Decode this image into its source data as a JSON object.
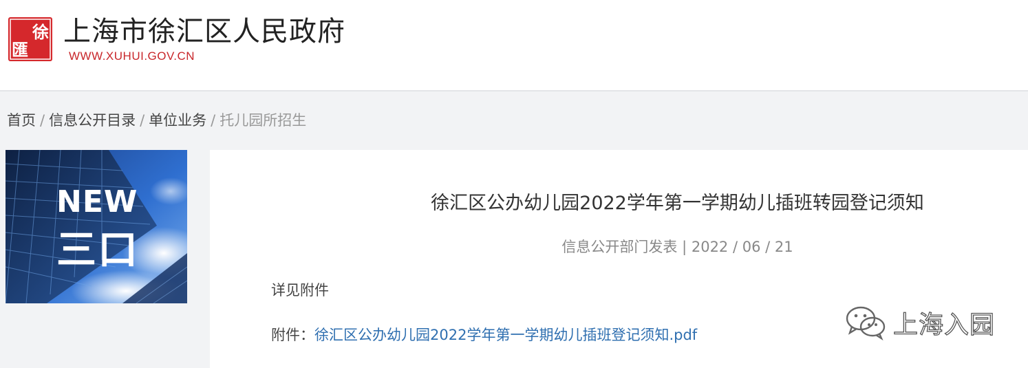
{
  "header": {
    "seal_glyphs": [
      "徐",
      "匯"
    ],
    "site_name": "上海市徐汇区人民政府",
    "site_url": "WWW.XUHUI.GOV.CN"
  },
  "breadcrumb": {
    "items": [
      "首页",
      "信息公开目录",
      "单位业务"
    ],
    "current": "托儿园所招生",
    "separator": "/"
  },
  "banner": {
    "title": "NEW",
    "subtitle": "三口"
  },
  "article": {
    "title": "徐汇区公办幼儿园2022学年第一学期幼儿插班转园登记须知",
    "publisher": "信息公开部门发表",
    "date": "2022 / 06 / 21",
    "meta_separator": "|",
    "body": "详见附件",
    "attachment_label": "附件：",
    "attachment_link": "徐汇区公办幼儿园2022学年第一学期幼儿插班登记须知.pdf"
  },
  "watermark": {
    "icon": "wechat-icon",
    "text": "上海入园"
  },
  "colors": {
    "brand_red": "#c8262a",
    "link_blue": "#2f6fb0",
    "page_bg": "#f2f3f5"
  }
}
